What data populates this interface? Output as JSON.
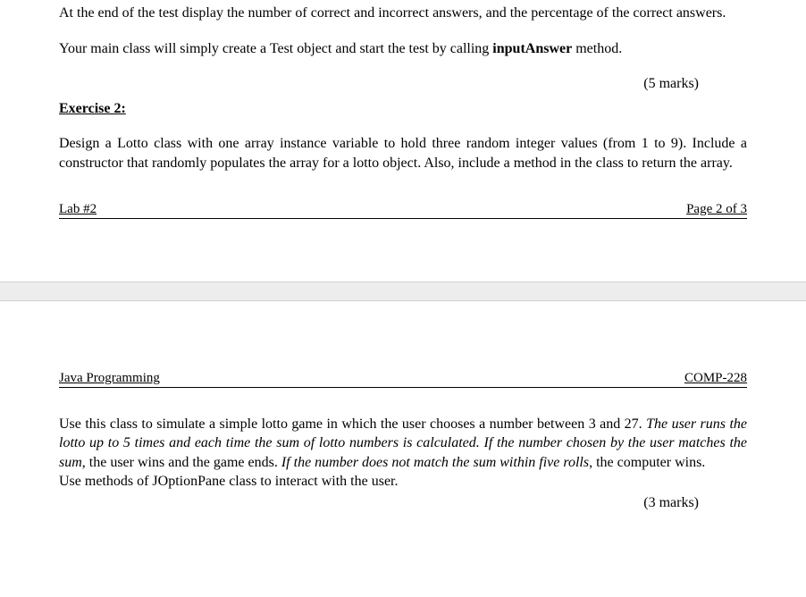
{
  "page1": {
    "para_end_test": "At the end of the test display the number of correct and incorrect answers, and the percentage of the correct answers.",
    "para_main_a": "Your main class will simply create a Test object and start the test by calling ",
    "para_main_bold": "inputAnswer",
    "para_main_b": " method.",
    "marks_5": "(5 marks)",
    "ex2_heading": "Exercise 2:",
    "ex2_para": "Design a Lotto class with one array instance variable to hold three random integer values (from 1 to 9). Include a constructor that randomly populates the array for a lotto object. Also, include a method in the class to return the array.",
    "footer_left": "Lab  #2",
    "footer_right": "Page 2 of 3"
  },
  "page2": {
    "header_left": "Java Programming",
    "header_right": "COMP-228",
    "line1_a": "Use this class to simulate a simple lotto game in which the user chooses a number between 3 and 27. ",
    "line1_italic": "The user runs the lotto up to 5 times and each time the sum of lotto numbers is calculated. If the number chosen by the user matches the sum",
    "line1_b": ", the user wins and the game ends. ",
    "line1_italic2": "If the number does not match the sum within five rolls",
    "line1_c": ", the computer wins.",
    "line2": "Use methods of JOptionPane class to interact with the user.",
    "marks_3": "(3 marks)"
  }
}
